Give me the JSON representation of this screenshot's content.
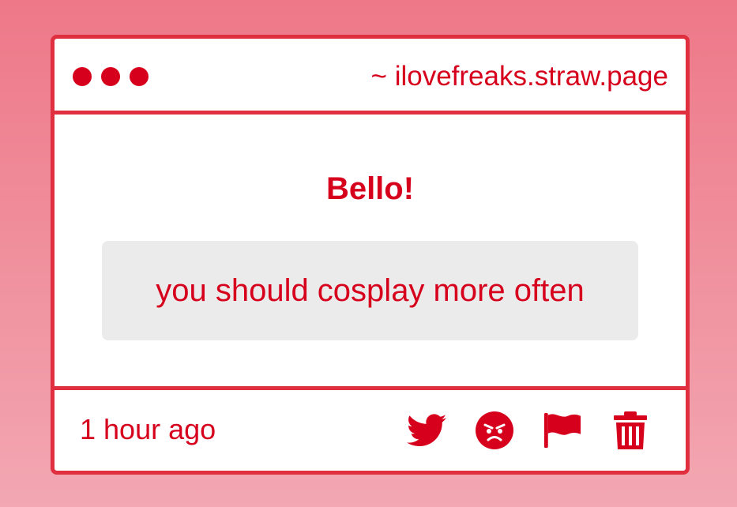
{
  "window": {
    "url": "~ ilovefreaks.straw.page"
  },
  "message": {
    "title": "Bello!",
    "body": "you should cosplay more often"
  },
  "footer": {
    "time": "1 hour ago",
    "actions": [
      {
        "icon": "twitter-icon"
      },
      {
        "icon": "angry-face-icon"
      },
      {
        "icon": "flag-icon"
      },
      {
        "icon": "trash-icon"
      }
    ]
  },
  "colors": {
    "accent": "#d6001c",
    "border": "#e0303f",
    "message_bg": "#ecebec",
    "background_top": "#ee7888",
    "background_bottom": "#f2a7b2"
  }
}
